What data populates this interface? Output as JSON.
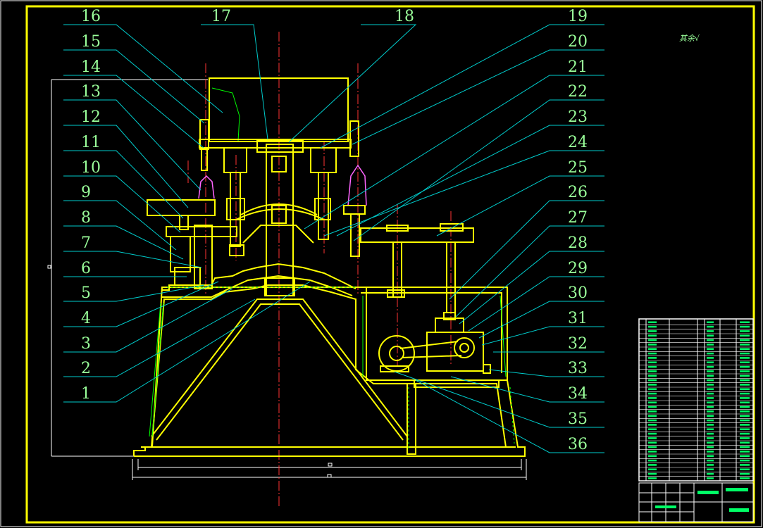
{
  "drawing": {
    "colors": {
      "background": "#000000",
      "outline": "#ffff00",
      "hatch": "#00ff00",
      "leader": "#00cccc",
      "center_line": "#ff3333",
      "label": "#9aff9a",
      "accent": "#ff66ff"
    },
    "roughness_note": "其余√",
    "part_labels": {
      "top_row": [
        "16",
        "17",
        "18",
        "19"
      ],
      "left": [
        "15",
        "14",
        "13",
        "12",
        "11",
        "10",
        "9",
        "8",
        "7",
        "6",
        "5",
        "4",
        "3",
        "2",
        "1"
      ],
      "right": [
        "20",
        "21",
        "22",
        "23",
        "24",
        "25",
        "26",
        "27",
        "28",
        "29",
        "30",
        "31",
        "32",
        "33",
        "34",
        "35",
        "36"
      ]
    },
    "title_block": {
      "parts_list_rows": 36
    }
  }
}
